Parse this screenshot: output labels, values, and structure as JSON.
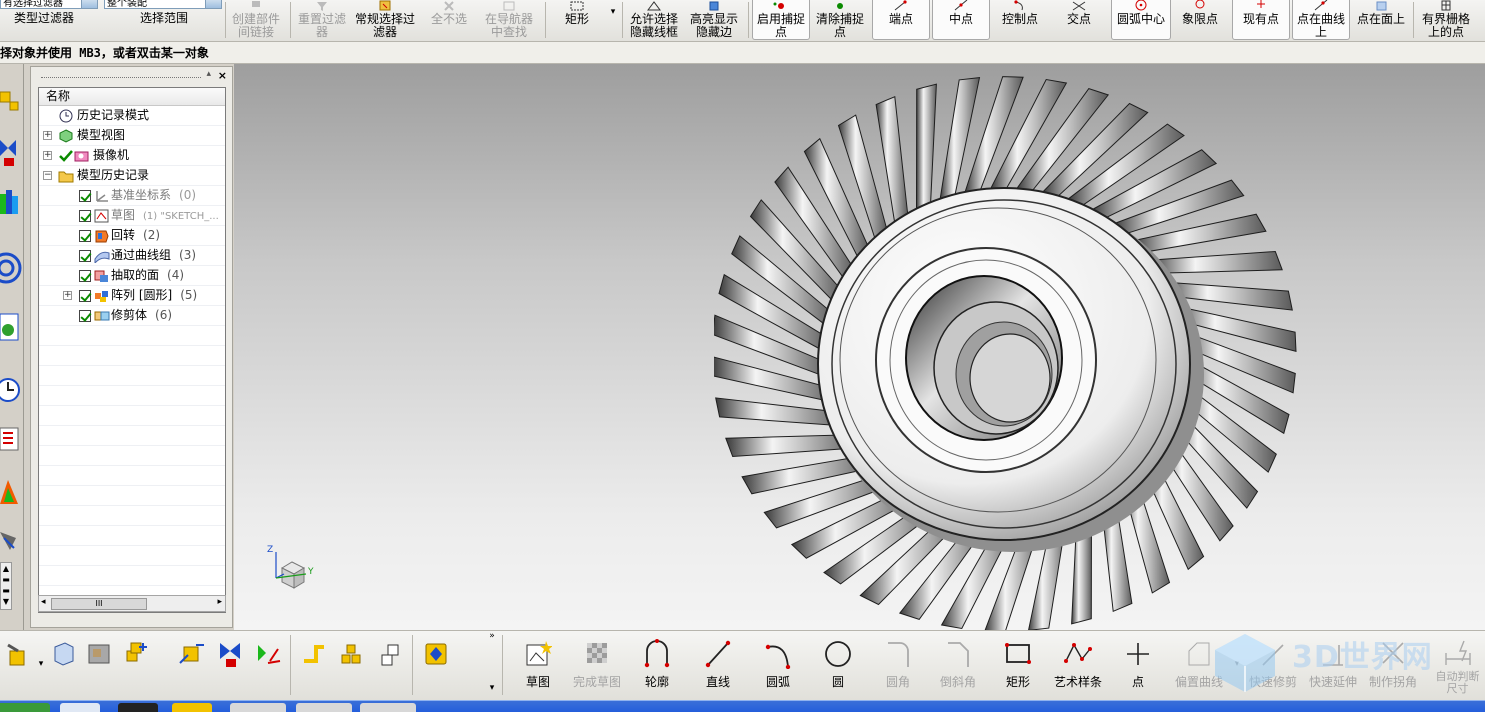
{
  "toolbar_top": {
    "filter_dropdown": "有选择过滤器",
    "scope_dropdown": "整个装配",
    "type_filter_label": "类型过滤器",
    "scope_label": "选择范围",
    "create_component_link": "创建部件间链接",
    "reset_filter": "重置过滤器",
    "general_filter": "常规选择过滤器",
    "deselect_all": "全不选",
    "in_navigator": "在导航器中查找",
    "rectangle": "矩形",
    "allow_hidden_wire": "允许选择隐藏线框",
    "highlight_hidden": "高亮显示隐藏边",
    "enable_snap": "启用捕捉点",
    "clear_snap": "清除捕捉点",
    "endpoint": "端点",
    "midpoint": "中点",
    "control_point": "控制点",
    "intersection": "交点",
    "arc_center": "圆弧中心",
    "quadrant": "象限点",
    "existing_point": "现有点",
    "point_on_curve": "点在曲线上",
    "point_on_face": "点在面上",
    "bounded_grid": "有界栅格上的点"
  },
  "cue_line": "择对象并使用 MB3，或者双击某一对象",
  "navigator": {
    "header": "名称",
    "items": [
      {
        "label": "历史记录模式",
        "count": ""
      },
      {
        "label": "模型视图",
        "count": ""
      },
      {
        "label": "摄像机",
        "count": ""
      },
      {
        "label": "模型历史记录",
        "count": ""
      },
      {
        "label": "基准坐标系",
        "count": "(0)"
      },
      {
        "label": "草图",
        "count": "(1) \"SKETCH_..."
      },
      {
        "label": "回转",
        "count": "(2)"
      },
      {
        "label": "通过曲线组",
        "count": "(3)"
      },
      {
        "label": "抽取的面",
        "count": "(4)"
      },
      {
        "label": "阵列 [圆形]",
        "count": "(5)"
      },
      {
        "label": "修剪体",
        "count": "(6)"
      }
    ],
    "scroll_thumb": "III"
  },
  "toolbar_bottom": {
    "sketch": "草图",
    "finish_sketch": "完成草图",
    "profile": "轮廓",
    "line": "直线",
    "arc": "圆弧",
    "circle": "圆",
    "fillet": "圆角",
    "chamfer": "倒斜角",
    "rectangle": "矩形",
    "studio_spline": "艺术样条",
    "point": "点",
    "offset_curve": "偏置曲线",
    "quick_trim": "快速修剪",
    "quick_extend": "快速延伸",
    "make_corner": "制作拐角",
    "auto_dimension": "自动判断尺寸"
  },
  "watermark": "3D世界网",
  "colors": {
    "accent_red": "#d40000",
    "check_green": "#0a8a00",
    "viewport_top": "#9e9e9e",
    "viewport_bottom": "#f4f4f4"
  }
}
